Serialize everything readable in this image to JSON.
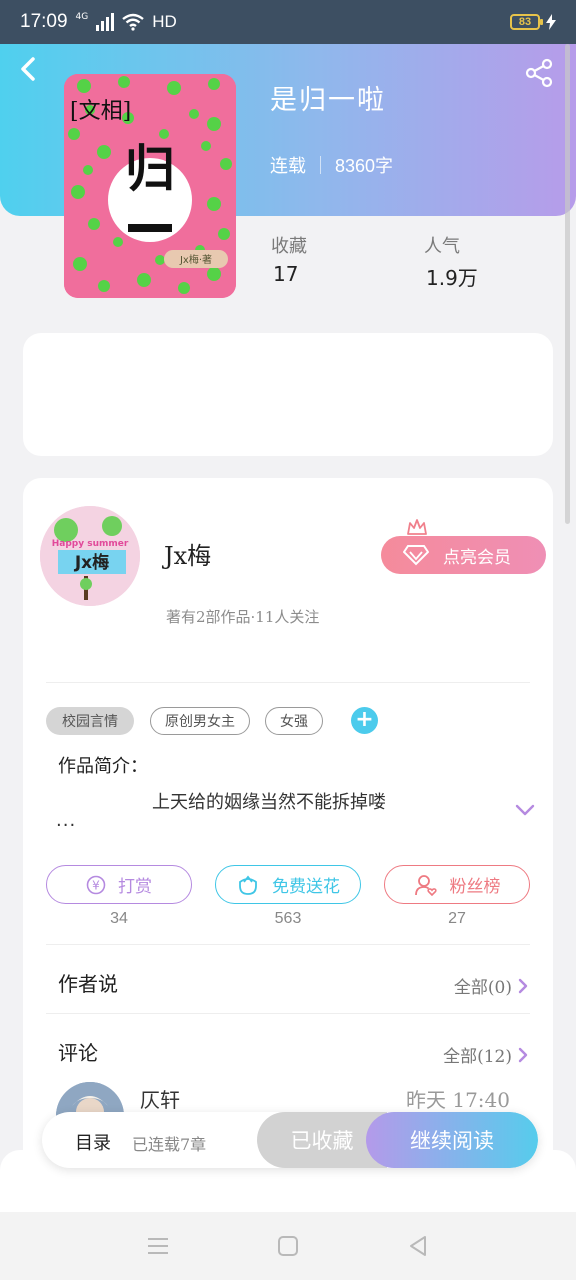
{
  "status_bar": {
    "time": "17:09",
    "network": "4G",
    "hd": "HD",
    "battery": "83"
  },
  "book": {
    "title": "是归一啦",
    "status": "连载",
    "word_count": "8360字",
    "stats": [
      {
        "label": "收藏",
        "value": "17"
      },
      {
        "label": "人气",
        "value": "1.9万"
      }
    ],
    "cover_text": {
      "tag": "[文相]",
      "big": "归",
      "sub": "Jx梅·著"
    }
  },
  "author": {
    "name": "Jx梅",
    "info": "著有2部作品·11人关注",
    "avatar_text": {
      "top": "Happy summer",
      "main": "Jx梅"
    },
    "vip_label": "点亮会员"
  },
  "tags": [
    "校园言情",
    "原创男女主",
    "女强"
  ],
  "intro": {
    "label": "作品简介：",
    "text": "上天给的姻缘当然不能拆掉喽",
    "more": "..."
  },
  "actions": [
    {
      "label": "打赏",
      "count": "34",
      "color": "#b58ae0"
    },
    {
      "label": "免费送花",
      "count": "563",
      "color": "#3fc6e6"
    },
    {
      "label": "粉丝榜",
      "count": "27",
      "color": "#ee7a82"
    }
  ],
  "author_says": {
    "title": "作者说",
    "link": "全部(0)"
  },
  "comments": {
    "title": "评论",
    "link": "全部(12)",
    "first": {
      "user": "仄轩",
      "time": "昨天 17:40"
    }
  },
  "bottom_bar": {
    "toc_label": "目录",
    "toc_status": "已连载7章",
    "collected_label": "已收藏",
    "read_label": "继续阅读"
  },
  "colors": {
    "header_start": "#4fd0ee",
    "header_end": "#b79cea",
    "accent_cyan": "#4ccbec",
    "vip_pink": "#f58b9b"
  }
}
